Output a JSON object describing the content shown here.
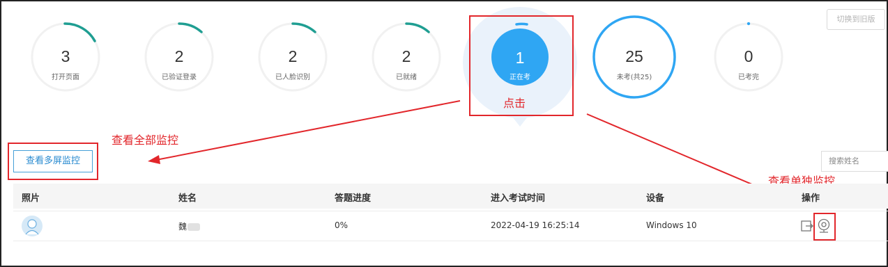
{
  "header": {
    "switch_button": "切换到旧版"
  },
  "stats": [
    {
      "value": "3",
      "label": "打开页面"
    },
    {
      "value": "2",
      "label": "已验证登录"
    },
    {
      "value": "2",
      "label": "已人脸识别"
    },
    {
      "value": "2",
      "label": "已就绪"
    },
    {
      "value": "1",
      "label": "正在考"
    },
    {
      "value": "25",
      "label": "未考(共25)"
    },
    {
      "value": "0",
      "label": "已考完"
    }
  ],
  "annotations": {
    "click": "点击",
    "view_all": "查看全部监控",
    "view_single": "查看单独监控"
  },
  "toolbar": {
    "multi_screen_button": "查看多屏监控",
    "search_placeholder": "搜索姓名"
  },
  "table": {
    "columns": [
      "照片",
      "姓名",
      "答题进度",
      "进入考试时间",
      "设备",
      "操作"
    ],
    "rows": [
      {
        "name": "魏",
        "progress": "0%",
        "entry_time": "2022-04-19 16:25:14",
        "device": "Windows 10"
      }
    ]
  },
  "colors": {
    "teal_arc": "#1f9e92",
    "blue": "#2fa6f3",
    "red_annotation": "#e2262b"
  },
  "icons": {
    "exit": "exit-icon",
    "camera": "camera-icon",
    "avatar": "avatar-icon"
  }
}
